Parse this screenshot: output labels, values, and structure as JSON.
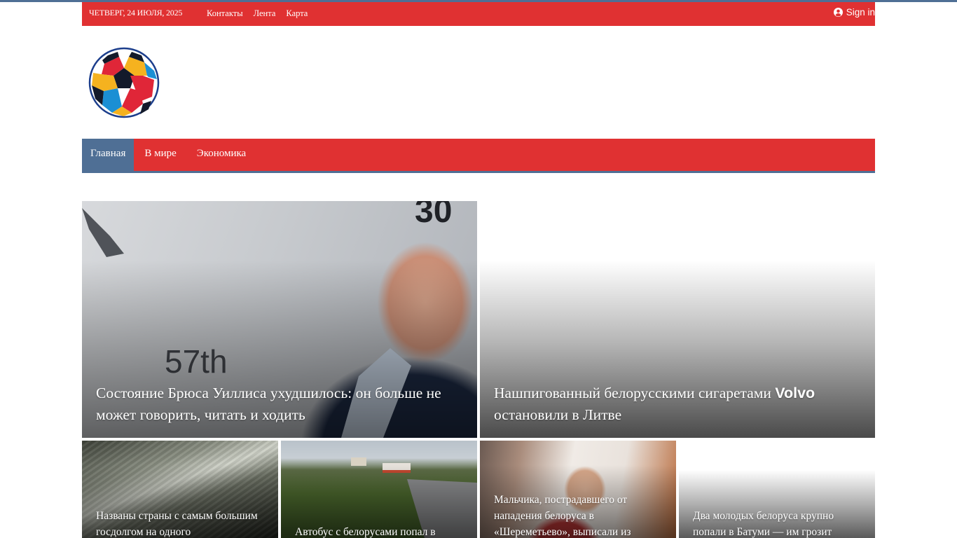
{
  "topbar": {
    "date": "ЧЕТВЕРГ, 24 ИЮЛЯ, 2025",
    "links": [
      "Контакты",
      "Лента",
      "Карта"
    ],
    "signin": "Sign in"
  },
  "nav": {
    "items": [
      "Главная",
      "В мире",
      "Экономика"
    ]
  },
  "articles": {
    "main_left": "Состояние Брюса Уиллиса ухудшилось: он больше не может говорить, читать и ходить",
    "main_right_a": "Нашпигованный белорусскими сигаретами ",
    "main_right_brand": "Volvo",
    "main_right_b": "остановили в Литве",
    "small_1": "Названы страны с самым большим госдолгом на одного",
    "small_2": "Автобус с белорусами попал в",
    "small_3": "Мальчика, пострадавшего от нападения белоруса в «Шереметьево», выписали из",
    "small_4": "Два молодых белоруса крупно попали в Батуми — им грозит"
  },
  "colors": {
    "accent_red": "#e03132",
    "accent_blue": "#4f6f95"
  }
}
